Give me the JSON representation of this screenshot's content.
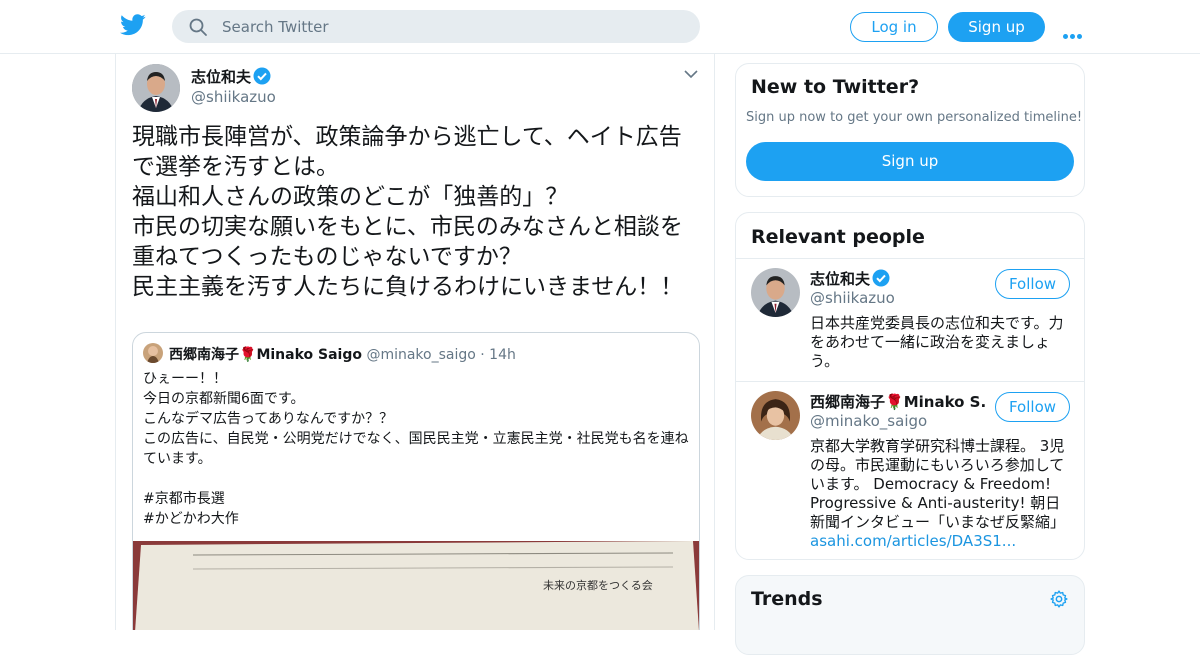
{
  "search": {
    "placeholder": "Search Twitter"
  },
  "header": {
    "login_label": "Log in",
    "signup_label": "Sign up"
  },
  "tweet": {
    "name": "志位和夫",
    "handle": "@shiikazuo",
    "text": "現職市長陣営が、政策論争から逃亡して、ヘイト広告で選挙を汚すとは。\n福山和人さんの政策のどこが「独善的」？\n市民の切実な願いをもとに、市民のみなさんと相談を重ねてつくったものじゃないですか？\n民主主義を汚す人たちに負けるわけにいきません！！",
    "quote": {
      "name": "西郷南海子",
      "name_suffix": "Minako Saigo",
      "handle": "@minako_saigo",
      "time": "14h",
      "text": "ひぇーー！！\n今日の京都新聞6面です。\nこんなデマ広告ってありなんですか？？\nこの広告に、自民党・公明党だけでなく、国民民主党・立憲民主党・社民党も名を連ねています。\n\n#京都市長選\n#かどかわ大作",
      "image_text": "未来の京都をつくる会"
    }
  },
  "sidebar": {
    "new_title": "New to Twitter?",
    "new_subtitle": "Sign up now to get your own personalized timeline!",
    "signup_label": "Sign up",
    "relevant_title": "Relevant people",
    "people": [
      {
        "name": "志位和夫",
        "handle": "@shiikazuo",
        "follow_label": "Follow",
        "bio": "日本共産党委員長の志位和夫です。力をあわせて一緒に政治を変えましょう。"
      },
      {
        "name": "西郷南海子",
        "name_suffix": "Minako S...",
        "handle": "@minako_saigo",
        "follow_label": "Follow",
        "bio": "京都大学教育学研究科博士課程。 3児の母。市民運動にもいろいろ参加しています。 Democracy & Freedom! Progressive & Anti-austerity! 朝日新聞インタビュー「いまなぜ反緊縮」",
        "bio_link": "asahi.com/articles/DA3S1..."
      }
    ],
    "trends_title": "Trends"
  },
  "colors": {
    "accent": "#1da1f2",
    "border": "#e6ecf0",
    "muted": "#657786"
  }
}
